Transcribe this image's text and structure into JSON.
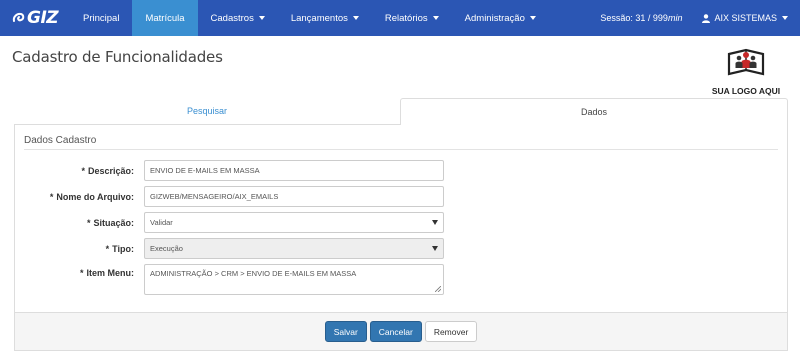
{
  "navbar": {
    "logo": "GIZ",
    "items": [
      {
        "label": "Principal",
        "dropdown": false,
        "active": false
      },
      {
        "label": "Matrícula",
        "dropdown": false,
        "active": true
      },
      {
        "label": "Cadastros",
        "dropdown": true,
        "active": false
      },
      {
        "label": "Lançamentos",
        "dropdown": true,
        "active": false
      },
      {
        "label": "Relatórios",
        "dropdown": true,
        "active": false
      },
      {
        "label": "Administração",
        "dropdown": true,
        "active": false
      }
    ],
    "session_label": "Sessão: 31 / 999",
    "session_unit": "min",
    "user": "AIX SISTEMAS",
    "colors": {
      "bar": "#2b56b4",
      "active": "#3a8fd1"
    }
  },
  "page": {
    "title": "Cadastro de Funcionalidades",
    "brand_caption": "SUA LOGO AQUI"
  },
  "tabs": [
    {
      "label": "Pesquisar",
      "active": false
    },
    {
      "label": "Dados",
      "active": true
    }
  ],
  "form": {
    "legend": "Dados Cadastro",
    "required_mark": "*",
    "fields": {
      "descricao": {
        "label": "Descrição:",
        "value": "ENVIO DE E-MAILS EM MASSA"
      },
      "nome_arquivo": {
        "label": "Nome do Arquivo:",
        "value": "GIZWEB/MENSAGEIRO/AIX_EMAILS"
      },
      "situacao": {
        "label": "Situação:",
        "value": "Validar"
      },
      "tipo": {
        "label": "Tipo:",
        "value": "Execução"
      },
      "item_menu": {
        "label": "Item Menu:",
        "value": "ADMINISTRAÇÃO > CRM > ENVIO DE E-MAILS EM MASSA"
      }
    }
  },
  "buttons": {
    "salvar": "Salvar",
    "cancelar": "Cancelar",
    "remover": "Remover"
  },
  "icons": [
    "swirl-logo-icon",
    "caret-down-icon",
    "user-icon",
    "people-book-icon",
    "select-arrow-icon",
    "resize-handle-icon"
  ]
}
